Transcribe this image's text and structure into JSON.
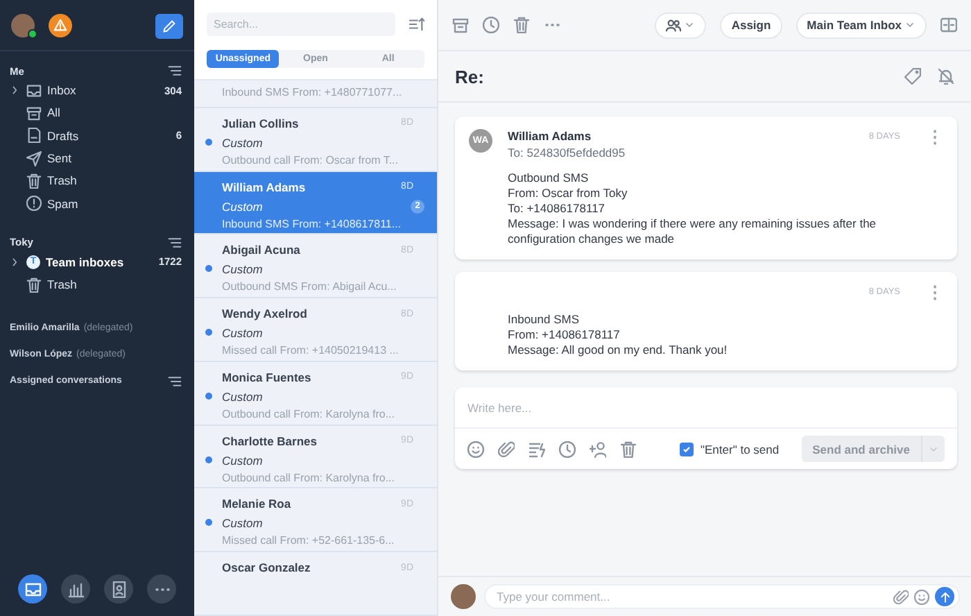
{
  "sidebar": {
    "user": {
      "online": true
    },
    "sections": [
      {
        "title": "Me",
        "items": [
          {
            "label": "Inbox",
            "count": "304",
            "expandable": true,
            "bold": false
          },
          {
            "label": "All",
            "expandable": false,
            "bold": false
          },
          {
            "label": "Drafts",
            "count": "6",
            "expandable": false,
            "bold": false
          },
          {
            "label": "Sent",
            "expandable": false,
            "bold": false
          },
          {
            "label": "Trash",
            "expandable": false,
            "bold": false
          },
          {
            "label": "Spam",
            "expandable": false,
            "bold": false
          }
        ]
      },
      {
        "title": "Toky",
        "items": [
          {
            "label": "Team inboxes",
            "letter": "T",
            "count": "1722",
            "expandable": true,
            "bold": true
          },
          {
            "label": "Trash",
            "expandable": false,
            "bold": false
          }
        ]
      }
    ],
    "delegated": [
      {
        "name": "Emilio Amarilla",
        "note": "(delegated)"
      },
      {
        "name": "Wilson López",
        "note": "(delegated)"
      }
    ],
    "assigned": "Assigned conversations",
    "nav": [
      {
        "selected": true
      },
      {
        "selected": false
      },
      {
        "selected": false
      },
      {
        "selected": false
      }
    ]
  },
  "list": {
    "search": {
      "placeholder": "Search..."
    },
    "tabs": [
      {
        "label": "Unassigned",
        "selected": true
      },
      {
        "label": "Open",
        "selected": false
      },
      {
        "label": "All",
        "selected": false
      }
    ],
    "conversations": [
      {
        "preview": "Inbound SMS From: +1480771077...",
        "selected": false
      },
      {
        "name": "Julian Collins",
        "time": "8D",
        "tag": "Custom",
        "preview": "Outbound call From: Oscar from T...",
        "unread": true,
        "selected": false
      },
      {
        "name": "William Adams",
        "time": "8D",
        "tag": "Custom",
        "preview": "Inbound SMS From: +1408617811...",
        "badge": "2",
        "unread": false,
        "selected": true
      },
      {
        "name": "Abigail Acuna",
        "time": "8D",
        "tag": "Custom",
        "preview": "Outbound SMS From: Abigail Acu...",
        "unread": true,
        "selected": false
      },
      {
        "name": "Wendy Axelrod",
        "time": "8D",
        "tag": "Custom",
        "preview": "Missed call From: +14050219413 ...",
        "unread": true,
        "selected": false
      },
      {
        "name": "Monica Fuentes",
        "time": "9D",
        "tag": "Custom",
        "preview": "Outbound call From: Karolyna fro...",
        "unread": true,
        "selected": false
      },
      {
        "name": "Charlotte Barnes",
        "time": "9D",
        "tag": "Custom",
        "preview": "Outbound call From: Karolyna fro...",
        "unread": true,
        "selected": false
      },
      {
        "name": "Melanie Roa",
        "time": "9D",
        "tag": "Custom",
        "preview": "Missed call From: +52-661-135-6...",
        "unread": true,
        "selected": false
      },
      {
        "name": "Oscar Gonzalez",
        "time": "9D",
        "unread": false,
        "selected": false
      }
    ]
  },
  "conversation": {
    "assign": "Assign",
    "inbox": "Main Team Inbox",
    "subject": "Re:",
    "messages": [
      {
        "initials": "WA",
        "sender": "William Adams",
        "to": "To: 524830f5efdedd95",
        "time": "8 DAYS",
        "lines": [
          "Outbound SMS",
          "From: Oscar from Toky",
          "To: +14086178117",
          "Message: I was wondering if there were any remaining issues after the configuration changes we made"
        ]
      },
      {
        "time": "8 DAYS",
        "lines": [
          "Inbound SMS",
          "From: +14086178117",
          "Message: All good on my end. Thank you!"
        ]
      }
    ],
    "composer": {
      "placeholder": "Write here...",
      "enter_to_send": {
        "label": "\"Enter\" to send",
        "checked": true
      },
      "send": {
        "label": "Send and archive",
        "disabled": true
      }
    },
    "comment": {
      "placeholder": "Type your comment..."
    }
  }
}
